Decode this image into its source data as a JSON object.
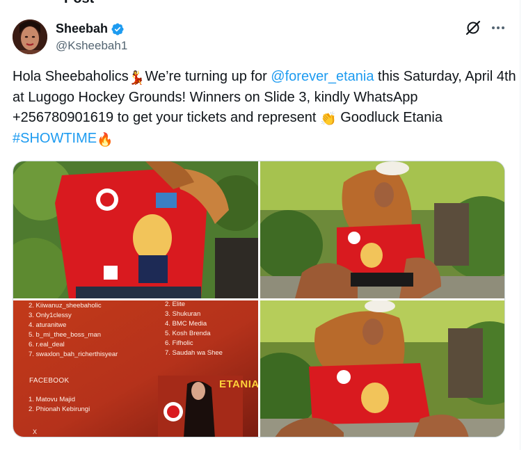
{
  "header": {
    "title": "Post"
  },
  "author": {
    "display_name": "Sheebah",
    "handle": "@Ksheebah1",
    "verified": true
  },
  "icons": {
    "verified": "verified-badge-icon",
    "grok": "grok-icon",
    "more": "more-options-icon"
  },
  "tweet": {
    "part1": "Hola Sheebaholics",
    "emoji1": "💃",
    "part2": "We’re turning up for ",
    "mention": "@forever_etania",
    "part3": " this Saturday, April 4th at Lugogo Hockey Grounds! Winners on Slide 3, kindly WhatsApp +256780901619 to get your tickets and represent ",
    "emoji2": "👏",
    "part4": " Goodluck Etania ",
    "hashtag": "#SHOWTIME",
    "emoji3": "🔥"
  },
  "slide3": {
    "left_list": [
      "2. Kiiwanuz_sheebaholic",
      "3. Only1clessy",
      "4. aturanitwe",
      "5. b_mi_thee_boss_man",
      "6. r.eal_deal",
      "7. swaxlon_bah_richerthisyear"
    ],
    "right_list": [
      "2. Elite",
      "3. Shukuran",
      "4. BMC Media",
      "5. Kosh Brenda",
      "6. Fifholic",
      "7. Saudah wa Shee"
    ],
    "facebook_heading": "FACEBOOK",
    "facebook_list": [
      "1. Matovu Majid",
      "2. Phionah Kebirungi"
    ],
    "footer_mark": "X",
    "poster_title": "ETANIA"
  },
  "colors": {
    "accent": "#1d9bf0",
    "text": "#0f1419",
    "muted": "#536471",
    "slide_bg": "#c8361a"
  }
}
